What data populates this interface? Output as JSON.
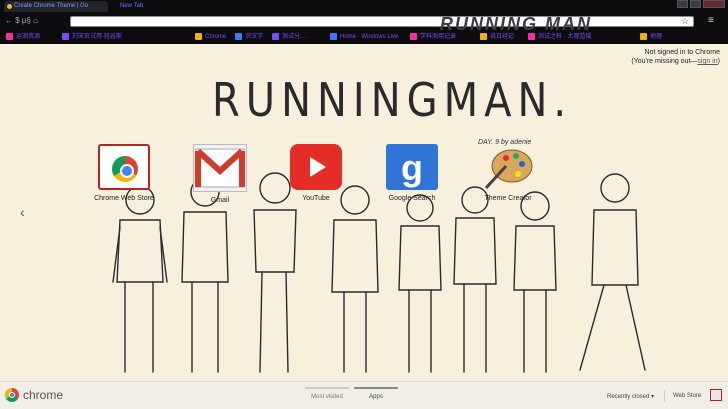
{
  "tabs": [
    {
      "label": "Create Chrome Theme | Go",
      "active": true
    },
    {
      "label": "New Tab",
      "active": false
    }
  ],
  "toolbar": {
    "nav": "← $ µ§ ⌂"
  },
  "bookmarks": [
    {
      "label": "运测资源",
      "color": "#ff2aa4"
    },
    {
      "label": "刘宋页试用·轻谷斯",
      "color": "#7b49ff"
    },
    {
      "label": "Chrome",
      "color": "#f0b400"
    },
    {
      "label": "识汉字",
      "color": "#3a78ff"
    },
    {
      "label": "测试分…",
      "color": "#7b49ff"
    },
    {
      "label": "Home · Windows Live",
      "color": "#3a78ff"
    },
    {
      "label": "学科测用记录",
      "color": "#ff2aa4"
    },
    {
      "label": "说日经记",
      "color": "#f0b400"
    },
    {
      "label": "测试之科 · 大观范域",
      "color": "#ff2aa4"
    },
    {
      "label": "地理",
      "color": "#f0b400"
    }
  ],
  "banner_deco": "RUNNING MAN",
  "signin": {
    "line1": "Not signed in to Chrome",
    "line2_prefix": "(You're missing out—",
    "link": "sign in",
    "line2_suffix": ")"
  },
  "theme": {
    "title": "RUNNINGMAN.",
    "subtitle": "DAY. 9   by adenie"
  },
  "apps": [
    {
      "label": "Chrome Web Store",
      "icon": "webstore-icon"
    },
    {
      "label": "Gmail",
      "icon": "gmail-icon"
    },
    {
      "label": "YouTube",
      "icon": "youtube-icon"
    },
    {
      "label": "Google Search",
      "icon": "google-search-icon"
    },
    {
      "label": "Theme Creator",
      "icon": "theme-creator-icon"
    }
  ],
  "nav_arrow": "‹",
  "bottombar": {
    "brand": "chrome",
    "pages": [
      {
        "label": "Most visited",
        "active": false
      },
      {
        "label": "Apps",
        "active": true
      }
    ],
    "recently_closed": "Recently closed ▾",
    "web_store": "Web Store"
  }
}
